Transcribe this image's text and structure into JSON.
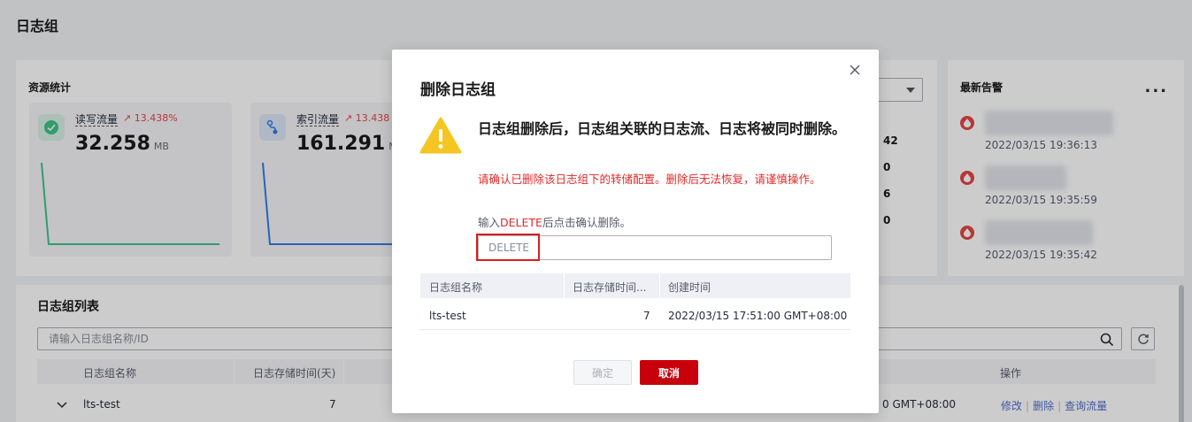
{
  "page": {
    "title": "日志组"
  },
  "resource": {
    "title": "资源统计",
    "cards": [
      {
        "label": "读写流量",
        "trend": "13.438%",
        "value": "32.258",
        "unit": "MB",
        "color": "#3ec48a"
      },
      {
        "label": "索引流量",
        "trend": "13.438",
        "value": "161.291",
        "unit": "MB",
        "color": "#2f7ee8"
      }
    ],
    "right_numbers": [
      "42",
      "0",
      "6",
      "0"
    ]
  },
  "alarms": {
    "title": "最新告警",
    "more": "...",
    "items": [
      {
        "time": "2022/03/15 19:36:13"
      },
      {
        "time": "2022/03/15 19:35:59"
      },
      {
        "time": "2022/03/15 19:35:42"
      }
    ]
  },
  "list": {
    "title": "日志组列表",
    "search_placeholder": "请输入日志组名称/ID",
    "columns": {
      "name": "日志组名称",
      "retention": "日志存储时间(天)",
      "actions": "操作"
    },
    "row": {
      "name": "lts-test",
      "retention": "7",
      "created_partial": "0 GMT+08:00",
      "actions": {
        "edit": "修改",
        "delete": "删除",
        "query": "查询流量"
      }
    }
  },
  "dialog": {
    "title": "删除日志组",
    "warning_main": "日志组删除后，日志组关联的日志流、日志将被同时删除。",
    "warning_sub": "请确认已删除该日志组下的转储配置。删除后无法恢复，请谨慎操作。",
    "hint_prefix": "输入",
    "hint_keyword": "DELETE",
    "hint_suffix": "后点击确认删除。",
    "input_placeholder": "DELETE",
    "table": {
      "columns": {
        "name": "日志组名称",
        "retention": "日志存储时间...",
        "created": "创建时间"
      },
      "row": {
        "name": "lts-test",
        "retention": "7",
        "created": "2022/03/15 17:51:00 GMT+08:00"
      }
    },
    "ok_label": "确定",
    "cancel_label": "取消"
  },
  "colors": {
    "brand_red": "#c7000b",
    "warning_red": "#e12a2a",
    "link": "#526ecc",
    "warn_yellow": "#f5c623"
  }
}
